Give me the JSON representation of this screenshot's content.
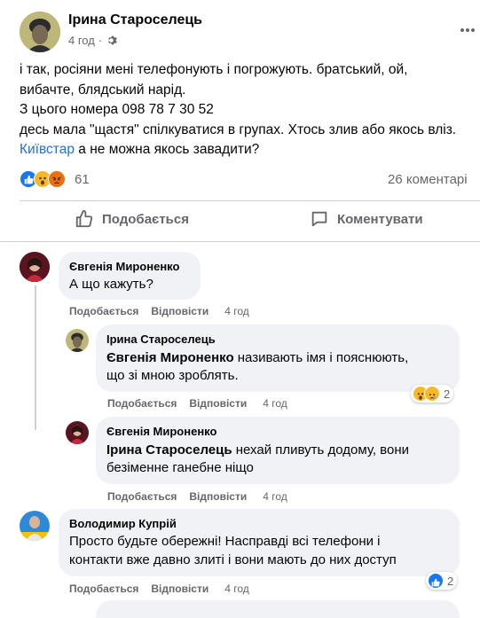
{
  "post": {
    "author": "Ірина Староселець",
    "time": "4 год",
    "lines": [
      "і так, росіяни мені  телефонують і погрожують. братський, ой,",
      "вибачте, блядський нарід.",
      "З  цього номера 098 78 7 30 52",
      "десь мала \"щастя\" спілкуватися в групах. Хтось злив або якось вліз."
    ],
    "mention": "Київстар",
    "last_line_rest": " а не можна якось завадити?",
    "reactions_count": "61",
    "comments_count": "26 коментарі",
    "like_label": "Подобається",
    "comment_label": "Коментувати"
  },
  "comments": [
    {
      "author": "Євгенія Мироненко",
      "text": "А що кажуть?",
      "like": "Подобається",
      "reply": "Відповісти",
      "time": "4 год"
    },
    {
      "author": "Ірина Староселець",
      "mention": "Євгенія Мироненко",
      "text1": " називають імя і пояснюють,",
      "text2": "що зі мною зроблять.",
      "like": "Подобається",
      "reply": "Відповісти",
      "time": "4 год",
      "reactions": "2"
    },
    {
      "author": "Євгенія Мироненко",
      "mention": "Ірина Староселець",
      "text1": " нехай пливуть додому, вони",
      "text2": "безіменне ганебне ніщо",
      "like": "Подобається",
      "reply": "Відповісти",
      "time": "4 год"
    },
    {
      "author": "Володимир Купрій",
      "text1": "Просто будьте обережні! Насправді всі телефони і",
      "text2": "контакти вже давно злиті і вони мають до них доступ",
      "like": "Подобається",
      "reply": "Відповісти",
      "time": "4 год",
      "reactions": "2"
    }
  ],
  "icons": {
    "audience": "gear-icon",
    "more": "more-dots-icon",
    "like": "thumbs-up-icon",
    "comment": "comment-bubble-icon"
  },
  "colors": {
    "link": "#216fdb",
    "muted": "#65676b",
    "bubble": "#f0f2f5",
    "like_blue": "#1877f2",
    "wow_yellow": "#f7b928",
    "angry_red": "#e9710f"
  }
}
